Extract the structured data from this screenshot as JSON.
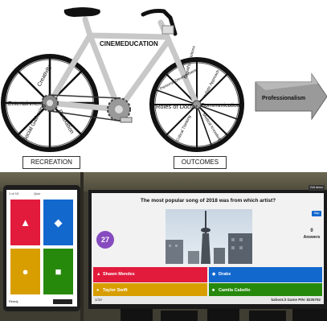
{
  "diagram": {
    "frame_label": "CINEMEDUCATION",
    "rear_wheel_labels": [
      "Creativity",
      "Entertainment",
      "Relaxation",
      "Social Gathering"
    ],
    "front_wheel_labels": [
      "Holistic Approach",
      "Communication",
      "Medical Knowledge",
      "Critical Thinking",
      "Roles of Doctor",
      "Personal Development",
      "Empathy/Emotions"
    ],
    "arrow_label": "Professionalism",
    "left_caption": "RECREATION",
    "right_caption": "OUTCOMES",
    "colors": {
      "frame": "#c8c8c8",
      "tire": "#111111",
      "arrow": "#9a9a9a"
    }
  },
  "photo": {
    "tablet": {
      "counter": "1 of 15",
      "mode": "Quiz",
      "status": "Ready",
      "tile_colors": [
        "#e21b3c",
        "#1368ce",
        "#d89e00",
        "#26890c"
      ],
      "tile_icons": [
        "triangle-icon",
        "diamond-icon",
        "circle-icon",
        "square-icon"
      ]
    },
    "screen": {
      "question": "The most popular song of 2018 was from which artist?",
      "timer": "27",
      "answers_count": "0",
      "answers_label": "Answers",
      "skip_label": "Skip",
      "exit_label": "Exit demo",
      "progress": "1/10",
      "footer": "kahoot.it  Game PIN: 8235792",
      "options": [
        {
          "text": "Shawn Mendes",
          "color": "#e21b3c",
          "icon": "triangle-icon"
        },
        {
          "text": "Drake",
          "color": "#1368ce",
          "icon": "diamond-icon"
        },
        {
          "text": "Taylor Swift",
          "color": "#d89e00",
          "icon": "circle-icon"
        },
        {
          "text": "Camila Cabello",
          "color": "#26890c",
          "icon": "square-icon"
        }
      ]
    }
  }
}
